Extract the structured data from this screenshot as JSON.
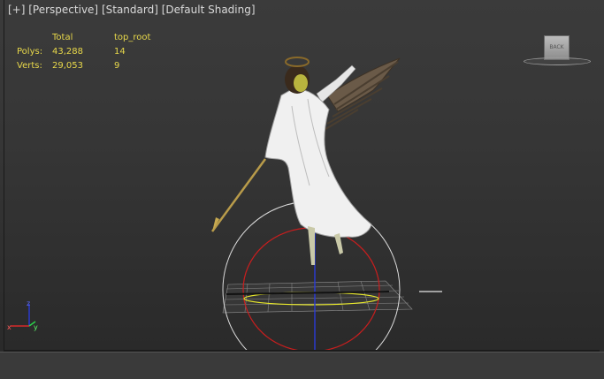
{
  "viewport": {
    "menu_plus": "[+]",
    "view_name": "[Perspective]",
    "render_mode": "[Standard]",
    "shading": "[Default Shading]"
  },
  "stats": {
    "header_total": "Total",
    "header_object": "top_root",
    "polys_label": "Polys:",
    "polys_total": "43,288",
    "polys_object": "14",
    "verts_label": "Verts:",
    "verts_total": "29,053",
    "verts_object": "9"
  },
  "viewcube": {
    "face_label": "BACK"
  },
  "axis": {
    "z": "z",
    "x": "x",
    "y": "y"
  },
  "colors": {
    "stats_text": "#e8d84a",
    "ring_red": "#c81e1e",
    "ring_white": "#dcdcdc",
    "axis_blue": "#2a3bd8",
    "axis_yellow": "#e8e82a"
  }
}
